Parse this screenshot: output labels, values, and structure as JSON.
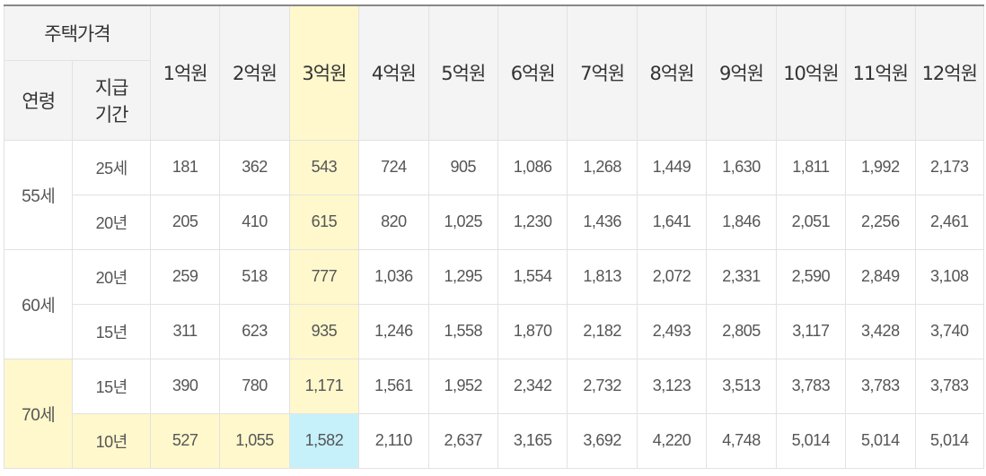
{
  "header": {
    "price_label": "주택가격",
    "age_label": "연령",
    "period_label_line1": "지급",
    "period_label_line2": "기간",
    "prices": [
      "1억원",
      "2억원",
      "3억원",
      "4억원",
      "5억원",
      "6억원",
      "7억원",
      "8억원",
      "9억원",
      "10억원",
      "11억원",
      "12억원"
    ]
  },
  "groups": [
    {
      "age": "55세",
      "rows": [
        {
          "period": "25세",
          "values": [
            "181",
            "362",
            "543",
            "724",
            "905",
            "1,086",
            "1,268",
            "1,449",
            "1,630",
            "1,811",
            "1,992",
            "2,173"
          ]
        },
        {
          "period": "20년",
          "values": [
            "205",
            "410",
            "615",
            "820",
            "1,025",
            "1,230",
            "1,436",
            "1,641",
            "1,846",
            "2,051",
            "2,256",
            "2,461"
          ]
        }
      ]
    },
    {
      "age": "60세",
      "rows": [
        {
          "period": "20년",
          "values": [
            "259",
            "518",
            "777",
            "1,036",
            "1,295",
            "1,554",
            "1,813",
            "2,072",
            "2,331",
            "2,590",
            "2,849",
            "3,108"
          ]
        },
        {
          "period": "15년",
          "values": [
            "311",
            "623",
            "935",
            "1,246",
            "1,558",
            "1,870",
            "2,182",
            "2,493",
            "2,805",
            "3,117",
            "3,428",
            "3,740"
          ]
        }
      ]
    },
    {
      "age": "70세",
      "rows": [
        {
          "period": "15년",
          "values": [
            "390",
            "780",
            "1,171",
            "1,561",
            "1,952",
            "2,342",
            "2,732",
            "3,123",
            "3,513",
            "3,783",
            "3,783",
            "3,783"
          ]
        },
        {
          "period": "10년",
          "values": [
            "527",
            "1,055",
            "1,582",
            "2,110",
            "2,637",
            "3,165",
            "3,692",
            "4,220",
            "4,748",
            "5,014",
            "5,014",
            "5,014"
          ]
        }
      ]
    }
  ],
  "colors": {
    "highlight_yellow": "#fff8cc",
    "highlight_blue": "#c6f1fb",
    "header_bg": "#f4f4f4"
  }
}
